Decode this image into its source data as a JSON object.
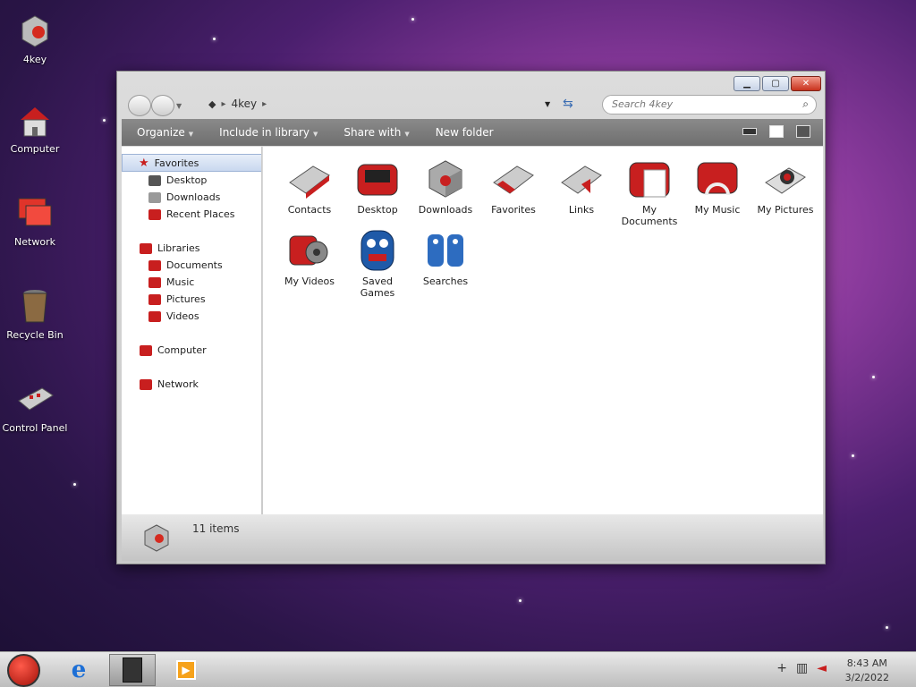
{
  "desktop": {
    "icons": [
      {
        "label": "4key",
        "icon": "box-icon"
      },
      {
        "label": "Computer",
        "icon": "computer-icon"
      },
      {
        "label": "Network",
        "icon": "network-icon"
      },
      {
        "label": "Recycle Bin",
        "icon": "recycle-bin-icon"
      },
      {
        "label": "Control Panel",
        "icon": "control-panel-icon"
      }
    ]
  },
  "window": {
    "address": {
      "location": "4key"
    },
    "search": {
      "placeholder": "Search 4key"
    },
    "toolbar": {
      "organize": "Organize",
      "include_in_library": "Include in library",
      "share_with": "Share with",
      "new_folder": "New folder"
    },
    "nav": {
      "favorites": "Favorites",
      "desktop": "Desktop",
      "downloads": "Downloads",
      "recent_places": "Recent Places",
      "libraries": "Libraries",
      "documents": "Documents",
      "music": "Music",
      "pictures": "Pictures",
      "videos": "Videos",
      "computer": "Computer",
      "network": "Network"
    },
    "items": [
      {
        "label": "Contacts",
        "icon": "contacts-icon"
      },
      {
        "label": "Desktop",
        "icon": "desktop-folder-icon"
      },
      {
        "label": "Downloads",
        "icon": "downloads-icon"
      },
      {
        "label": "Favorites",
        "icon": "favorites-icon"
      },
      {
        "label": "Links",
        "icon": "links-icon"
      },
      {
        "label": "My Documents",
        "icon": "documents-icon"
      },
      {
        "label": "My Music",
        "icon": "music-icon"
      },
      {
        "label": "My Pictures",
        "icon": "pictures-icon"
      },
      {
        "label": "My Videos",
        "icon": "videos-icon"
      },
      {
        "label": "Saved Games",
        "icon": "saved-games-icon"
      },
      {
        "label": "Searches",
        "icon": "searches-icon"
      }
    ],
    "details": {
      "count": "11 items"
    }
  },
  "taskbar": {
    "clock_time": "8:43 AM",
    "clock_date": "3/2/2022"
  },
  "colors": {
    "accent": "#c8321d",
    "toolbar": "#7a7a7a"
  }
}
